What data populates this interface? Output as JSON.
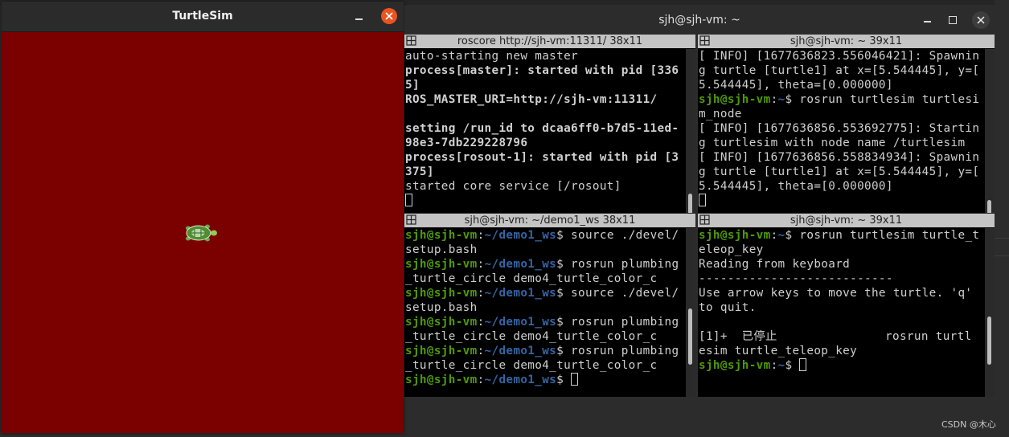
{
  "turtlesim": {
    "title": "TurtleSim",
    "background": "#7b0000"
  },
  "terminator": {
    "title": "sjh@sjh-vm: ~",
    "panes": [
      {
        "header": "roscore http://sjh-vm:11311/ 38x11",
        "lines": [
          [
            {
              "t": "auto-starting new master",
              "c": ""
            }
          ],
          [
            {
              "t": "process[master]: started with pid [336",
              "c": "b"
            }
          ],
          [
            {
              "t": "5]",
              "c": "b"
            }
          ],
          [
            {
              "t": "ROS_MASTER_URI=http://sjh-vm:11311/",
              "c": "b"
            }
          ],
          [
            {
              "t": "",
              "c": ""
            }
          ],
          [
            {
              "t": "setting /run_id to dcaa6ff0-b7d5-11ed-",
              "c": "b"
            }
          ],
          [
            {
              "t": "98e3-7db229228796",
              "c": "b"
            }
          ],
          [
            {
              "t": "process[rosout-1]: started with pid [3",
              "c": "b"
            }
          ],
          [
            {
              "t": "375]",
              "c": "b"
            }
          ],
          [
            {
              "t": "started core service [/rosout]",
              "c": ""
            }
          ],
          [
            {
              "t": "",
              "c": "cursor"
            }
          ]
        ]
      },
      {
        "header": "sjh@sjh-vm: ~ 39x11",
        "lines": [
          [
            {
              "t": "[ INFO] [1677636823.556046421]: Spawnin",
              "c": ""
            }
          ],
          [
            {
              "t": "g turtle [turtle1] at x=[5.544445], y=[",
              "c": ""
            }
          ],
          [
            {
              "t": "5.544445], theta=[0.000000]",
              "c": ""
            }
          ],
          [
            {
              "t": "sjh@sjh-vm",
              "c": "pg"
            },
            {
              "t": ":",
              "c": ""
            },
            {
              "t": "~",
              "c": "pb"
            },
            {
              "t": "$ rosrun turtlesim turtlesi",
              "c": ""
            }
          ],
          [
            {
              "t": "m_node",
              "c": ""
            }
          ],
          [
            {
              "t": "[ INFO] [1677636856.553692775]: Startin",
              "c": ""
            }
          ],
          [
            {
              "t": "g turtlesim with node name /turtlesim",
              "c": ""
            }
          ],
          [
            {
              "t": "[ INFO] [1677636856.558834934]: Spawnin",
              "c": ""
            }
          ],
          [
            {
              "t": "g turtle [turtle1] at x=[5.544445], y=[",
              "c": ""
            }
          ],
          [
            {
              "t": "5.544445], theta=[0.000000]",
              "c": ""
            }
          ],
          [
            {
              "t": "",
              "c": "cursor"
            }
          ]
        ]
      },
      {
        "header": "sjh@sjh-vm: ~/demo1_ws 38x11",
        "lines": [
          [
            {
              "t": "sjh@sjh-vm",
              "c": "pg"
            },
            {
              "t": ":",
              "c": ""
            },
            {
              "t": "~/demo1_ws",
              "c": "pb"
            },
            {
              "t": "$ source ./devel/",
              "c": ""
            }
          ],
          [
            {
              "t": "setup.bash",
              "c": ""
            }
          ],
          [
            {
              "t": "sjh@sjh-vm",
              "c": "pg"
            },
            {
              "t": ":",
              "c": ""
            },
            {
              "t": "~/demo1_ws",
              "c": "pb"
            },
            {
              "t": "$ rosrun plumbing",
              "c": ""
            }
          ],
          [
            {
              "t": "_turtle_circle demo4_turtle_color_c",
              "c": ""
            }
          ],
          [
            {
              "t": "sjh@sjh-vm",
              "c": "pg"
            },
            {
              "t": ":",
              "c": ""
            },
            {
              "t": "~/demo1_ws",
              "c": "pb"
            },
            {
              "t": "$ source ./devel/",
              "c": ""
            }
          ],
          [
            {
              "t": "setup.bash",
              "c": ""
            }
          ],
          [
            {
              "t": "sjh@sjh-vm",
              "c": "pg"
            },
            {
              "t": ":",
              "c": ""
            },
            {
              "t": "~/demo1_ws",
              "c": "pb"
            },
            {
              "t": "$ rosrun plumbing",
              "c": ""
            }
          ],
          [
            {
              "t": "_turtle_circle demo4_turtle_color_c",
              "c": ""
            }
          ],
          [
            {
              "t": "sjh@sjh-vm",
              "c": "pg"
            },
            {
              "t": ":",
              "c": ""
            },
            {
              "t": "~/demo1_ws",
              "c": "pb"
            },
            {
              "t": "$ rosrun plumbing",
              "c": ""
            }
          ],
          [
            {
              "t": "_turtle_circle demo4_turtle_color_c",
              "c": ""
            }
          ],
          [
            {
              "t": "sjh@sjh-vm",
              "c": "pg"
            },
            {
              "t": ":",
              "c": ""
            },
            {
              "t": "~/demo1_ws",
              "c": "pb"
            },
            {
              "t": "$ ",
              "c": ""
            },
            {
              "t": "",
              "c": "cursor"
            }
          ]
        ]
      },
      {
        "header": "sjh@sjh-vm: ~ 39x11",
        "lines": [
          [
            {
              "t": "sjh@sjh-vm",
              "c": "pg"
            },
            {
              "t": ":",
              "c": ""
            },
            {
              "t": "~",
              "c": "pb"
            },
            {
              "t": "$ rosrun turtlesim turtle_t",
              "c": ""
            }
          ],
          [
            {
              "t": "eleop_key",
              "c": ""
            }
          ],
          [
            {
              "t": "Reading from keyboard",
              "c": ""
            }
          ],
          [
            {
              "t": "---------------------------",
              "c": ""
            }
          ],
          [
            {
              "t": "Use arrow keys to move the turtle. 'q'",
              "c": ""
            }
          ],
          [
            {
              "t": "to quit.",
              "c": ""
            }
          ],
          [
            {
              "t": "",
              "c": ""
            }
          ],
          [
            {
              "t": "[1]+  已停止               rosrun turtl",
              "c": ""
            }
          ],
          [
            {
              "t": "esim turtle_teleop_key",
              "c": ""
            }
          ],
          [
            {
              "t": "sjh@sjh-vm",
              "c": "pg"
            },
            {
              "t": ":",
              "c": ""
            },
            {
              "t": "~",
              "c": "pb"
            },
            {
              "t": "$ ",
              "c": ""
            },
            {
              "t": "",
              "c": "cursor"
            }
          ]
        ]
      }
    ]
  },
  "watermark": "CSDN @木心",
  "colors": {
    "prompt_user": "#4e9a06",
    "prompt_path": "#3465a4",
    "pane_header": "#c4c4c4",
    "close_button": "#e95420"
  }
}
